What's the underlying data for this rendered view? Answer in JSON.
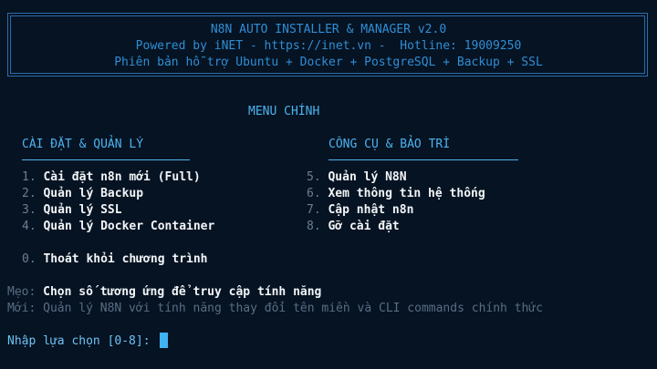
{
  "banner": {
    "title": "N8N AUTO INSTALLER & MANAGER v2.0",
    "powered": "Powered by iNET - https://inet.vn -  Hotline: 19009250",
    "support": "Phiên bản hỗ trợ Ubuntu + Docker + PostgreSQL + Backup + SSL"
  },
  "menu": {
    "title": "MENU CHÍNH",
    "left_section": "CÀI ĐẶT & QUẢN LÝ",
    "right_section": "CÔNG CỤ & BẢO TRÌ",
    "left_items": [
      {
        "num": "1.",
        "label": "Cài đặt n8n mới (Full)"
      },
      {
        "num": "2.",
        "label": "Quản lý Backup"
      },
      {
        "num": "3.",
        "label": "Quản lý SSL"
      },
      {
        "num": "4.",
        "label": "Quản lý Docker Container"
      }
    ],
    "right_items": [
      {
        "num": "5.",
        "label": "Quản lý N8N"
      },
      {
        "num": "6.",
        "label": "Xem thông tin hệ thống"
      },
      {
        "num": "7.",
        "label": "Cập nhật n8n"
      },
      {
        "num": "8.",
        "label": "Gỡ cài đặt"
      }
    ],
    "exit": {
      "num": "0.",
      "label": "Thoát khỏi chương trình"
    }
  },
  "hints": {
    "tip_label": "Mẹo:",
    "tip_text": "Chọn số tương ứng để truy cập tính năng",
    "new_label": "Mới:",
    "new_text": "Quản lý N8N với tính năng thay đổi tên miền và CLI commands chính thức"
  },
  "prompt": {
    "text": "Nhập lựa chọn [0-8]:"
  }
}
